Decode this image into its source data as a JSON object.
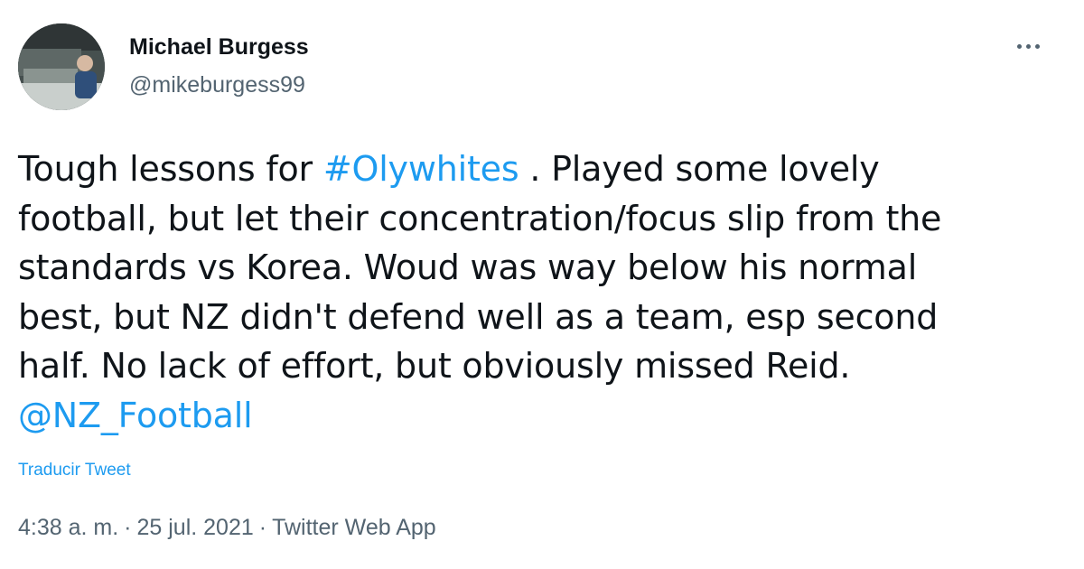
{
  "author": {
    "name": "Michael Burgess",
    "handle": "@mikeburgess99"
  },
  "tweet": {
    "lines": [
      [
        "Tough lessons for ",
        "#Olywhites",
        " . Played some lovely"
      ],
      [
        "football, but let their concentration/focus slip from the"
      ],
      [
        "standards vs Korea. Woud was way below his normal"
      ],
      [
        "best, but NZ didn't defend well as a team, esp second"
      ],
      [
        "half. No lack of effort, but obviously missed Reid."
      ],
      [
        "@NZ_Football"
      ]
    ],
    "translate_label": "Traducir Tweet"
  },
  "meta": {
    "time": "4:38 a. m.",
    "separator": "·",
    "date": "25 jul. 2021",
    "source": "Twitter Web App"
  },
  "icons": {
    "avatar": "profile-photo",
    "more": "more-options-icon"
  },
  "colors": {
    "link": "#1d9bf0",
    "text": "#0f1419",
    "secondary": "#536471"
  }
}
